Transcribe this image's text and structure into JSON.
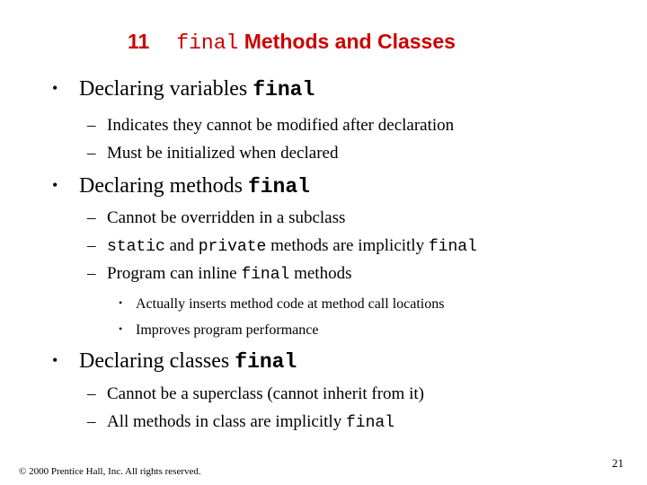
{
  "slide": {
    "title": {
      "number": "11",
      "code": "final",
      "text": "Methods and Classes"
    },
    "title_color": "#cc0000",
    "sections": [
      {
        "bullet": "•",
        "text": "Declaring variables ",
        "code": "final",
        "items": [
          {
            "dash": "–",
            "text": "Indicates they cannot be modified after declaration"
          },
          {
            "dash": "–",
            "text": "Must be initialized when declared"
          }
        ]
      },
      {
        "bullet": "•",
        "text": "Declaring methods ",
        "code": "final",
        "items": [
          {
            "dash": "–",
            "text": "Cannot be overridden in a subclass"
          },
          {
            "dash": "–",
            "code1": "static",
            "mid1": " and ",
            "code2": "private",
            "mid2": " methods are implicitly ",
            "code3": "final"
          },
          {
            "dash": "–",
            "pre": "Program can inline ",
            "code": "final",
            "post": " methods",
            "subitems": [
              {
                "bullet": "•",
                "text": "Actually inserts method code at method call locations"
              },
              {
                "bullet": "•",
                "text": "Improves program performance"
              }
            ]
          }
        ]
      },
      {
        "bullet": "•",
        "text": "Declaring classes ",
        "code": "final",
        "items": [
          {
            "dash": "–",
            "text": "Cannot be a superclass (cannot inherit from it)"
          },
          {
            "dash": "–",
            "pre": "All methods in class are implicitly ",
            "code": "final"
          }
        ]
      }
    ],
    "footer": "© 2000 Prentice Hall, Inc.  All rights reserved.",
    "page_number": "21"
  }
}
